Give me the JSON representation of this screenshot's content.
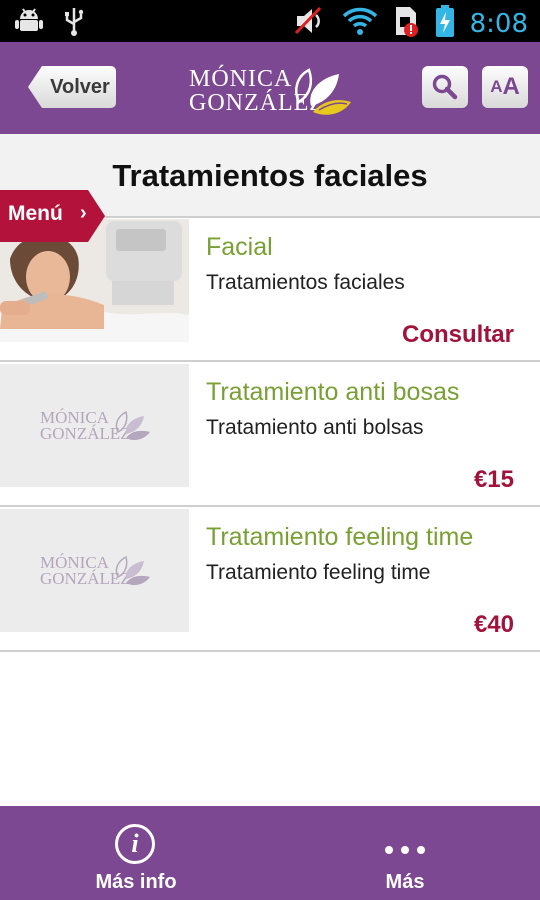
{
  "status_bar": {
    "time": "8:08",
    "left_icons": [
      "android-debug-icon",
      "usb-icon"
    ],
    "right_icons": [
      "mute-icon",
      "wifi-icon",
      "sim-alert-icon",
      "battery-icon"
    ]
  },
  "header": {
    "back_label": "Volver",
    "logo_line1": "MÓNICA",
    "logo_line2": "GONZÁLEZ",
    "font_small": "A",
    "font_large": "A"
  },
  "page": {
    "title": "Tratamientos faciales",
    "menu_label": "Menú"
  },
  "items": [
    {
      "name": "Facial",
      "description": "Tratamientos faciales",
      "price": "Consultar",
      "has_photo": true
    },
    {
      "name": "Tratamiento anti bosas",
      "description": "Tratamiento anti bolsas",
      "price": "€15",
      "has_photo": false
    },
    {
      "name": "Tratamiento feeling time",
      "description": "Tratamiento feeling time",
      "price": "€40",
      "has_photo": false
    }
  ],
  "placeholder_logo": {
    "line1": "MÓNICA",
    "line2": "GONZÁLEZ"
  },
  "bottom_nav": {
    "info_glyph": "i",
    "info_label": "Más info",
    "more_label": "Más"
  },
  "colors": {
    "brand_purple": "#7d4892",
    "accent_red": "#a3123a",
    "item_green": "#78a032",
    "status_blue": "#33b5e5"
  }
}
